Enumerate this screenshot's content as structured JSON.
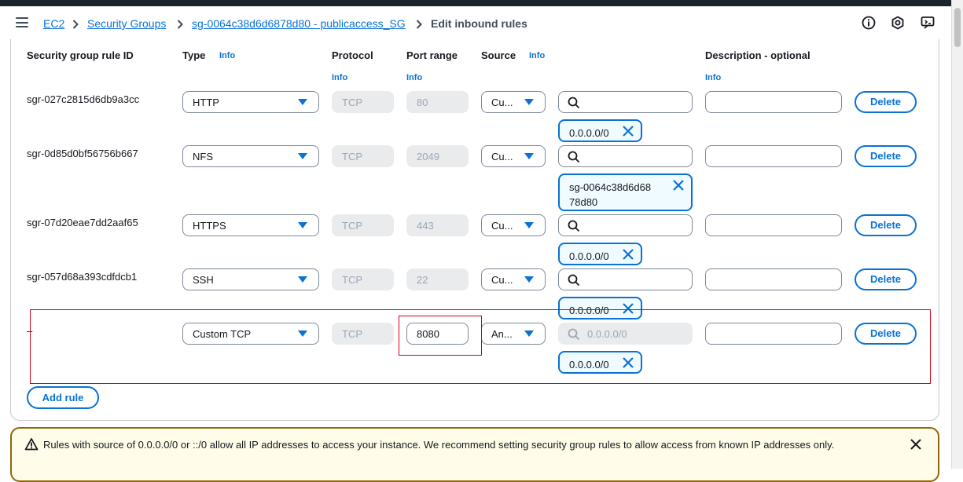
{
  "breadcrumb": {
    "items": [
      "EC2",
      "Security Groups",
      "sg-0064c38d6d6878d80 - publicaccess_SG",
      "Edit inbound rules"
    ]
  },
  "header_icons": [
    "info-icon",
    "settings-hex-icon",
    "feedback-icon"
  ],
  "columns": {
    "rule_id": "Security group rule ID",
    "type": "Type",
    "type_info": "Info",
    "protocol": "Protocol",
    "protocol_info": "Info",
    "port": "Port range",
    "port_info": "Info",
    "source": "Source",
    "source_info": "Info",
    "description": "Description - optional",
    "description_info": "Info"
  },
  "rules": [
    {
      "id": "sgr-027c2815d6db9a3cc",
      "type": "HTTP",
      "protocol": "TCP",
      "port": "80",
      "source": "Cu...",
      "token": "0.0.0.0/0",
      "delete": "Delete"
    },
    {
      "id": "sgr-0d85d0bf56756b667",
      "type": "NFS",
      "protocol": "TCP",
      "port": "2049",
      "source": "Cu...",
      "token": "sg-0064c38d6d68 78d80",
      "delete": "Delete"
    },
    {
      "id": "sgr-07d20eae7dd2aaf65",
      "type": "HTTPS",
      "protocol": "TCP",
      "port": "443",
      "source": "Cu...",
      "token": "0.0.0.0/0",
      "delete": "Delete"
    },
    {
      "id": "sgr-057d68a393cdfdcb1",
      "type": "SSH",
      "protocol": "TCP",
      "port": "22",
      "source": "Cu...",
      "token": "0.0.0.0/0",
      "delete": "Delete"
    },
    {
      "id": "–",
      "type": "Custom TCP",
      "protocol": "TCP",
      "port": "8080",
      "source": "An...",
      "search_placeholder": "0.0.0.0/0",
      "token": "0.0.0.0/0",
      "delete": "Delete"
    }
  ],
  "add_rule": "Add rule",
  "warning": {
    "text": "Rules with source of 0.0.0.0/0 or ::/0 allow all IP addresses to access your instance. We recommend setting security group rules to allow access from known IP addresses only."
  },
  "colors": {
    "accent": "#0972d3",
    "highlight": "#d0021b",
    "warning_border": "#8d6605"
  }
}
